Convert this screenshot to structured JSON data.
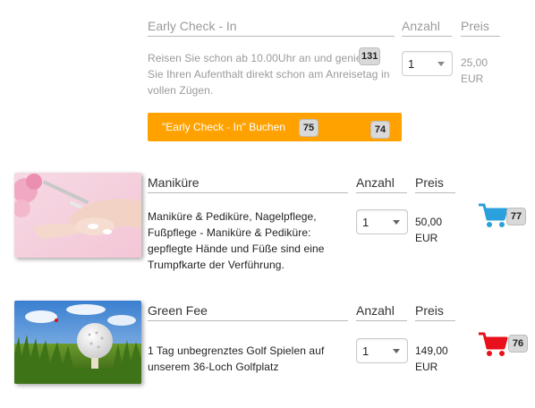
{
  "early_checkin": {
    "title": "Early Check - In",
    "col_qty": "Anzahl",
    "col_price": "Preis",
    "description": "Reisen Sie schon ab 10.00Uhr an und genießen Sie Ihren Aufenthalt direkt schon am Anreisetag in vollen Zügen.",
    "qty": "1",
    "price": "25,00",
    "currency": "EUR",
    "badge": "131",
    "button_label": "\"Early Check - In\" Buchen",
    "button_badge_a": "75",
    "button_badge_b": "74",
    "button_color": "#ffa200"
  },
  "items": [
    {
      "title": "Maniküre",
      "col_qty": "Anzahl",
      "col_price": "Preis",
      "description": "Maniküre & Pediküre, Nagelpflege, Fußpflege - Maniküre & Pediküre: gepflegte Hände und Füße sind eine Trumpfkarte der Verführung.",
      "qty": "1",
      "price": "50,00",
      "currency": "EUR",
      "cart_icon": "cart-icon",
      "cart_color": "#2aa0dc",
      "badge": "77"
    },
    {
      "title": "Green Fee",
      "col_qty": "Anzahl",
      "col_price": "Preis",
      "description": "1 Tag unbegrenztes Golf Spielen auf unserem 36-Loch Golfplatz",
      "qty": "1",
      "price": "149,00",
      "currency": "EUR",
      "cart_icon": "cart-icon",
      "cart_color": "#e8101a",
      "badge": "76"
    }
  ]
}
